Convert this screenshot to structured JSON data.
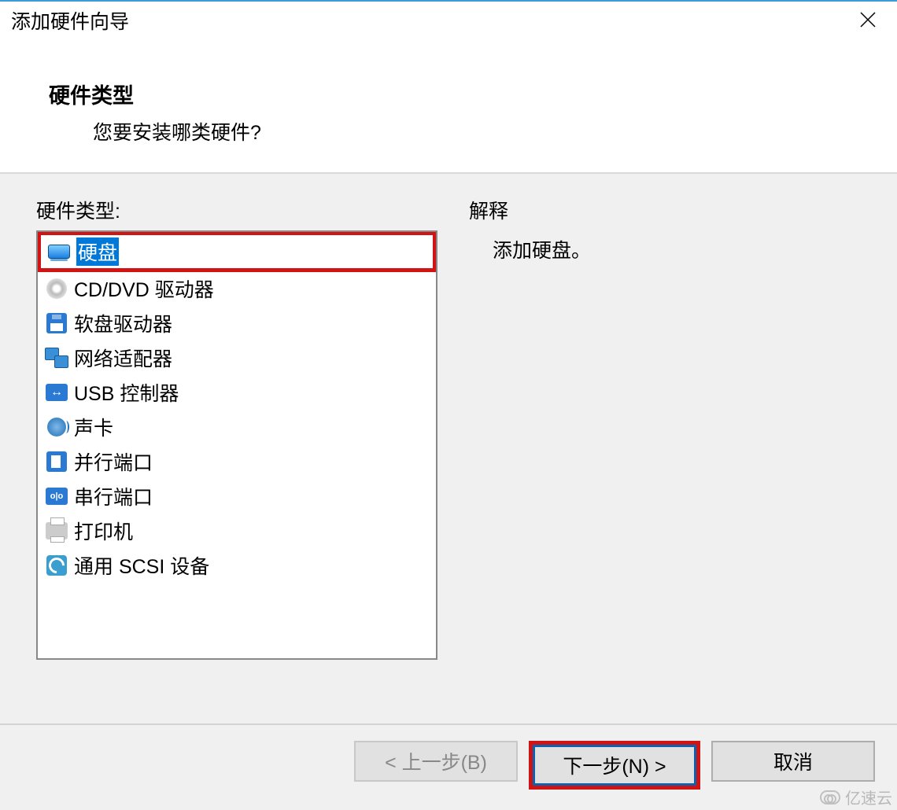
{
  "window": {
    "title": "添加硬件向导"
  },
  "header": {
    "heading": "硬件类型",
    "subheading": "您要安装哪类硬件?"
  },
  "left": {
    "label": "硬件类型:",
    "items": [
      {
        "id": "hard-disk",
        "label": "硬盘",
        "selected": true
      },
      {
        "id": "cd-dvd-drive",
        "label": "CD/DVD 驱动器",
        "selected": false
      },
      {
        "id": "floppy-drive",
        "label": "软盘驱动器",
        "selected": false
      },
      {
        "id": "network-adapter",
        "label": "网络适配器",
        "selected": false
      },
      {
        "id": "usb-controller",
        "label": "USB 控制器",
        "selected": false
      },
      {
        "id": "sound-card",
        "label": "声卡",
        "selected": false
      },
      {
        "id": "parallel-port",
        "label": "并行端口",
        "selected": false
      },
      {
        "id": "serial-port",
        "label": "串行端口",
        "selected": false
      },
      {
        "id": "printer",
        "label": "打印机",
        "selected": false
      },
      {
        "id": "generic-scsi",
        "label": "通用 SCSI 设备",
        "selected": false
      }
    ]
  },
  "right": {
    "label": "解释",
    "text": "添加硬盘。"
  },
  "footer": {
    "back": "< 上一步(B)",
    "next": "下一步(N) >",
    "cancel": "取消"
  },
  "watermark": "亿速云",
  "annotations": {
    "highlighted_item": "hard-disk",
    "highlighted_button": "next"
  }
}
